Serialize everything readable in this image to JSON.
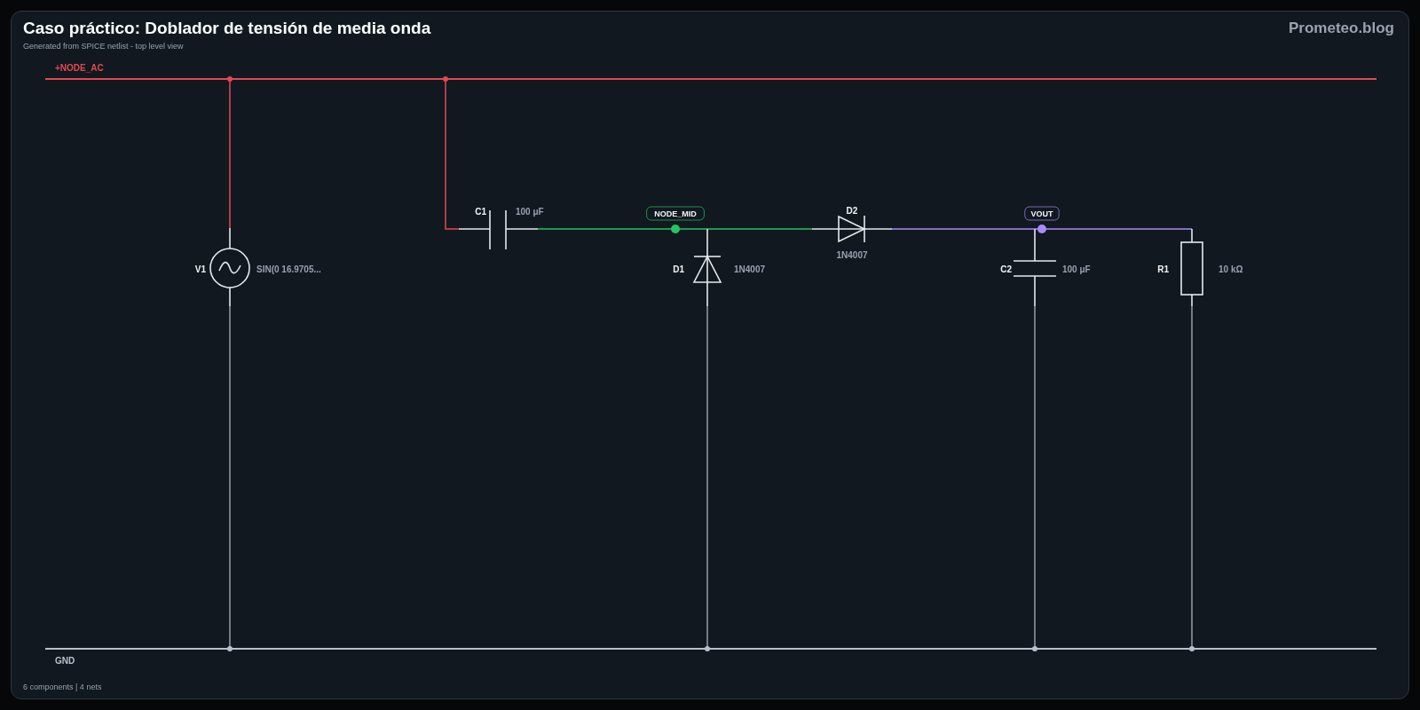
{
  "header": {
    "title": "Caso práctico: Doblador de tensión de media onda",
    "subtitle": "Generated from SPICE netlist - top level view",
    "brand": "Prometeo.blog"
  },
  "nets": [
    {
      "name": "+NODE_AC",
      "kind": "rail",
      "color": "#e5484d"
    },
    {
      "name": "NODE_MID",
      "kind": "tag",
      "color": "#22c55e"
    },
    {
      "name": "VOUT",
      "kind": "tag",
      "color": "#a78bfa"
    },
    {
      "name": "GND",
      "kind": "ground",
      "color": "#b8c0cc"
    }
  ],
  "components": [
    {
      "designator": "V1",
      "value": "SIN(0 16.9705...",
      "kind": "source"
    },
    {
      "designator": "C1",
      "value": "100 μF",
      "kind": "capacitor"
    },
    {
      "designator": "D1",
      "value": "1N4007",
      "kind": "diode"
    },
    {
      "designator": "D2",
      "value": "1N4007",
      "kind": "diode"
    },
    {
      "designator": "C2",
      "value": "100 μF",
      "kind": "capacitor"
    },
    {
      "designator": "R1",
      "value": "10 kΩ",
      "kind": "resistor"
    }
  ],
  "footer": "6 components | 4 nets"
}
